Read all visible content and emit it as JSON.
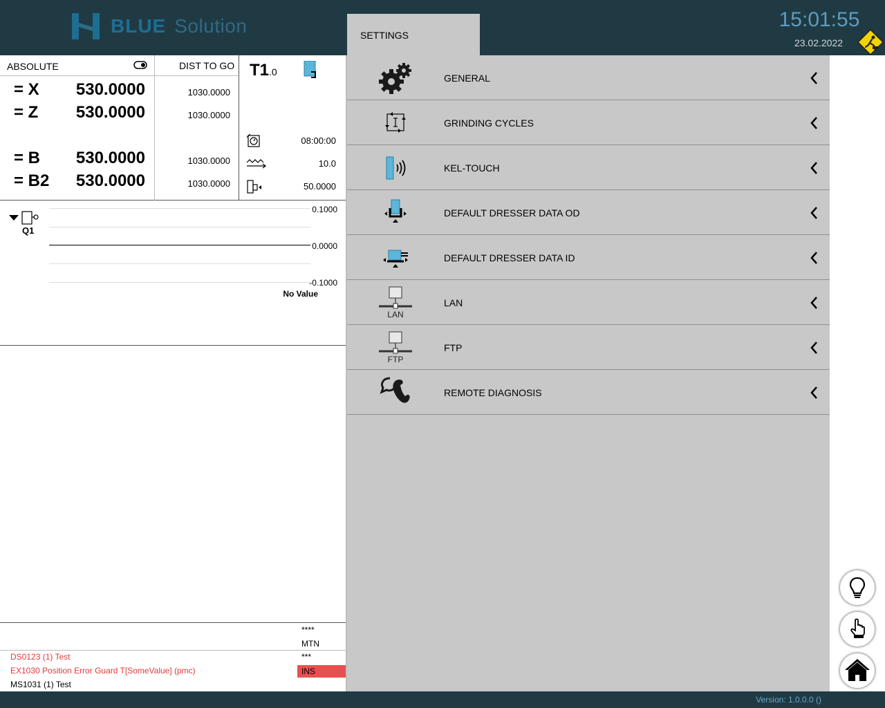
{
  "header": {
    "brand_bold": "BLUE",
    "brand_light": "Solution",
    "active_tab": "SETTINGS",
    "time": "15:01:55",
    "date": "23.02.2022"
  },
  "positions": {
    "absolute_label": "ABSOLUTE",
    "dist_label": "DIST TO GO",
    "axes": [
      {
        "name": "= X",
        "value": "530.0000",
        "dist": "1030.0000"
      },
      {
        "name": "= Z",
        "value": "530.0000",
        "dist": "1030.0000"
      },
      {
        "name": "= B",
        "value": "530.0000",
        "dist": "1030.0000"
      },
      {
        "name": "= B2",
        "value": "530.0000",
        "dist": "1030.0000"
      }
    ]
  },
  "tool": {
    "name": "T1",
    "sub": ".0",
    "time": "08:00:00",
    "feed": "10.0",
    "position": "50.0000"
  },
  "graph": {
    "label": "Q1",
    "top_value": "0.1000",
    "mid_value": "0.0000",
    "bottom_value": "-0.1000",
    "status": "No Value"
  },
  "messages": {
    "items": [
      {
        "text": "DS0123 (1) Test"
      },
      {
        "text": "EX1030 Position Error Guard T[SomeValue] (pmc)"
      },
      {
        "text": "MS1031 (1) Test"
      }
    ],
    "status": [
      "****",
      "MTN",
      "***",
      "INS"
    ]
  },
  "settings_menu": [
    {
      "label": "GENERAL",
      "icon": "gears-icon"
    },
    {
      "label": "GRINDING CYCLES",
      "icon": "grinding-cycles-icon"
    },
    {
      "label": "KEL-TOUCH",
      "icon": "kel-touch-icon"
    },
    {
      "label": "DEFAULT DRESSER DATA OD",
      "icon": "dresser-od-icon"
    },
    {
      "label": "DEFAULT DRESSER DATA ID",
      "icon": "dresser-id-icon"
    },
    {
      "label": "LAN",
      "icon": "lan-icon",
      "icon_caption": "LAN"
    },
    {
      "label": "FTP",
      "icon": "ftp-icon",
      "icon_caption": "FTP"
    },
    {
      "label": "REMOTE DIAGNOSIS",
      "icon": "remote-diagnosis-icon"
    }
  ],
  "footer": {
    "version": "Version: 1.0.0.0 ()"
  },
  "colors": {
    "header_bg": "#203a44",
    "panel_bg": "#c8c8c8",
    "accent_blue": "#1d6e93",
    "alert_red": "#e85050"
  }
}
